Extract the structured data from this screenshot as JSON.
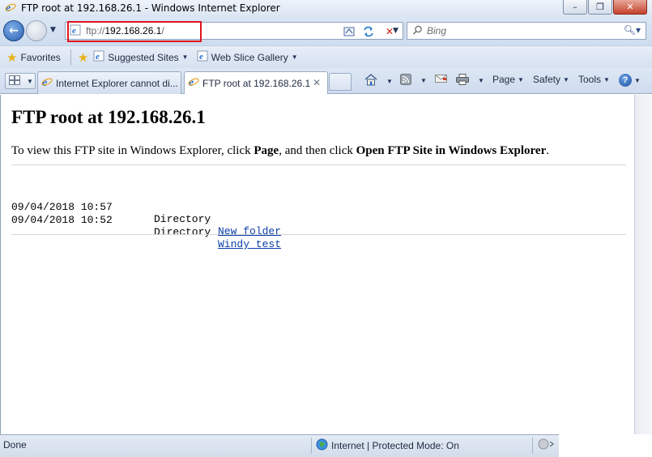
{
  "window": {
    "title": "FTP root at 192.168.26.1 - Windows Internet Explorer",
    "controls": {
      "minimize": "–",
      "maximize": "❐",
      "close": "✕"
    }
  },
  "address": {
    "protocol": "ftp://",
    "host": "192.168.26.1",
    "trailing": "/"
  },
  "search": {
    "placeholder": "Bing"
  },
  "favorites": {
    "label": "Favorites",
    "items": [
      {
        "label": "Suggested Sites"
      },
      {
        "label": "Web Slice Gallery"
      }
    ]
  },
  "tabs": [
    {
      "label": "Internet Explorer cannot di...",
      "active": false
    },
    {
      "label": "FTP root at 192.168.26.1",
      "active": true,
      "close": "✕"
    }
  ],
  "commands": {
    "page": "Page",
    "safety": "Safety",
    "tools": "Tools",
    "help": "?"
  },
  "page": {
    "heading": "FTP root at 192.168.26.1",
    "intro_prefix": "To view this FTP site in Windows Explorer, click ",
    "intro_page": "Page",
    "intro_middle": ", and then click ",
    "intro_action": "Open FTP Site in Windows Explorer",
    "intro_suffix": ".",
    "entries": [
      {
        "date": "09/04/2018 10:57",
        "kind": "Directory",
        "name": "New folder"
      },
      {
        "date": "09/04/2018 10:52",
        "kind": "Directory",
        "name": "Windy test"
      }
    ]
  },
  "status": {
    "text": "Done",
    "zone": "Internet | Protected Mode: On"
  },
  "colors": {
    "highlight": "#e0141e",
    "link": "#0b3ea8"
  }
}
